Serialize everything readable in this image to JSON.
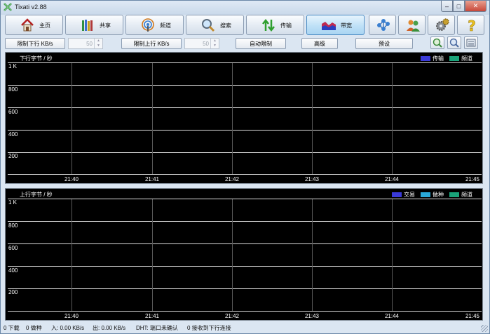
{
  "window": {
    "title": "Tixati v2.88"
  },
  "toolbar": {
    "home": "主页",
    "share": "共享",
    "channels": "频道",
    "search": "搜索",
    "transfers": "传输",
    "bandwidth": "带宽"
  },
  "limits": {
    "down_label": "限制下行 KB/s",
    "down_value": "50",
    "up_label": "限制上行 KB/s",
    "up_value": "50",
    "auto_label": "自动限制",
    "advanced_label": "高级",
    "presets_label": "预设"
  },
  "download_graph": {
    "title": "下行字节 / 秒",
    "legend": [
      {
        "label": "传输",
        "color": "#3a3ad8"
      },
      {
        "label": "频道",
        "color": "#1aa37a"
      }
    ],
    "y_ticks": [
      "1 K",
      "800",
      "600",
      "400",
      "200"
    ],
    "x_ticks": [
      "21:40",
      "21:41",
      "21:42",
      "21:43",
      "21:44",
      "21:45"
    ]
  },
  "upload_graph": {
    "title": "上行字节 / 秒",
    "legend": [
      {
        "label": "交易",
        "color": "#3a3ad8"
      },
      {
        "label": "做种",
        "color": "#2aa8d8"
      },
      {
        "label": "频道",
        "color": "#1aa37a"
      }
    ],
    "y_ticks": [
      "1 K",
      "800",
      "600",
      "400",
      "200"
    ],
    "x_ticks": [
      "21:40",
      "21:41",
      "21:42",
      "21:43",
      "21:44",
      "21:45"
    ]
  },
  "status": {
    "downloads": "0 下载",
    "seeds": "0 做种",
    "in": "入: 0.00 KB/s",
    "out": "出: 0.00 KB/s",
    "dht": "DHT: 端口未确认",
    "incoming": "0 接收到下行连接"
  },
  "colors": {
    "graph_bg": "#000000",
    "active_tab": "#bfe1f7"
  }
}
